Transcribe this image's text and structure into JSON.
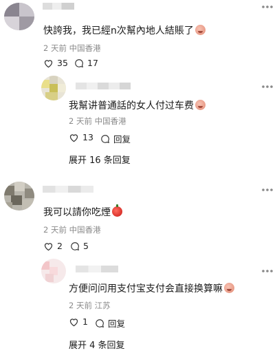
{
  "comments": [
    {
      "text": "快誇我，我已經n次幫內地人結賬了",
      "meta": "2 天前  中国香港",
      "likes": "35",
      "replies": "17",
      "emoji": "face-emoji"
    },
    {
      "text": "我幫讲普通話的女人付过车费",
      "meta": "2 天前  中国香港",
      "likes": "13",
      "reply_label": "回复",
      "emoji": "face-emoji",
      "more": "展开 16 条回复"
    },
    {
      "text": "我可以請你吃煙",
      "meta": "2 天前  中国香港",
      "likes": "2",
      "replies": "5",
      "emoji": "apple-emoji"
    },
    {
      "text": "方便问问用支付宝支付会直接换算嘛",
      "meta": "2 天前  江苏",
      "likes": "1",
      "reply_label": "回复",
      "emoji": "face-emoji",
      "more": "展开 4 条回复"
    }
  ]
}
